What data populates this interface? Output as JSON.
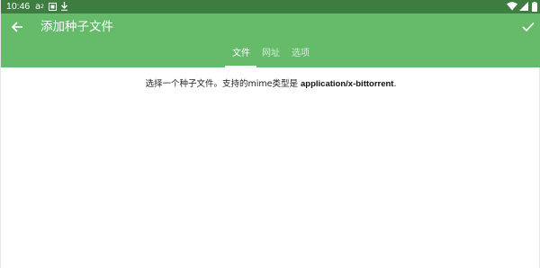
{
  "status_bar": {
    "time": "10:46",
    "indicator_a": "a",
    "indicator_a_sup": "2",
    "icons": [
      "a-superscript-icon",
      "screenshot-icon",
      "download-icon",
      "wifi-icon",
      "signal-icon",
      "battery-icon"
    ]
  },
  "app_bar": {
    "title": "添加种子文件",
    "back_icon": "arrow-back-icon",
    "confirm_icon": "check-icon"
  },
  "tabs": [
    {
      "label": "文件",
      "active": true
    },
    {
      "label": "网址",
      "active": false
    },
    {
      "label": "选项",
      "active": false
    }
  ],
  "content": {
    "message_prefix": "选择一个种子文件。支持的mime类型是 ",
    "mime_type": "application/x-bittorrent",
    "message_suffix": "."
  },
  "colors": {
    "status_bar": "#3e7d42",
    "app_bar": "#66bb6a",
    "background": "#ffffff",
    "text": "#222222"
  }
}
